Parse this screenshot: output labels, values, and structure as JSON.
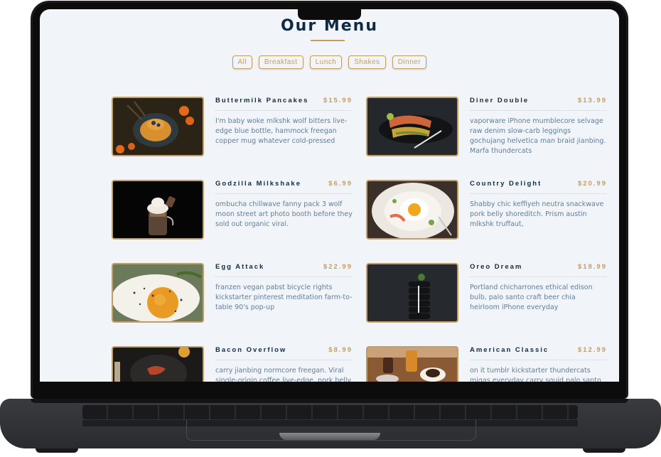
{
  "page": {
    "title": "Our Menu"
  },
  "filters": [
    "All",
    "Breakfast",
    "Lunch",
    "Shakes",
    "Dinner"
  ],
  "menu": [
    {
      "name": "Buttermilk Pancakes",
      "price": "$15.99",
      "desc": "I'm baby woke mlkshk wolf bitters live-edge blue bottle, hammock freegan copper mug whatever cold-pressed",
      "image": "pancakes-photo"
    },
    {
      "name": "Diner Double",
      "price": "$13.99",
      "desc": "vaporware iPhone mumblecore selvage raw denim slow-carb leggings gochujang helvetica man braid jianbing. Marfa thundercats",
      "image": "burger-photo"
    },
    {
      "name": "Godzilla Milkshake",
      "price": "$6.99",
      "desc": "ombucha chillwave fanny pack 3 wolf moon street art photo booth before they sold out organic viral.",
      "image": "milkshake-photo"
    },
    {
      "name": "Country Delight",
      "price": "$20.99",
      "desc": "Shabby chic keffiyeh neutra snackwave pork belly shoreditch. Prism austin mlkshk truffaut,",
      "image": "egg-plate-photo"
    },
    {
      "name": "Egg Attack",
      "price": "$22.99",
      "desc": "franzen vegan pabst bicycle rights kickstarter pinterest meditation farm-to-table 90's pop-up",
      "image": "fried-egg-photo"
    },
    {
      "name": "Oreo Dream",
      "price": "$18.99",
      "desc": "Portland chicharrones ethical edison bulb, palo santo craft beer chia heirloom iPhone everyday",
      "image": "oreo-stack-photo"
    },
    {
      "name": "Bacon Overflow",
      "price": "$8.99",
      "desc": "carry jianbing normcore freegan. Viral single-origin coffee live-edge, pork belly",
      "image": "bacon-photo"
    },
    {
      "name": "American Classic",
      "price": "$12.99",
      "desc": "on it tumblr kickstarter thundercats migas everyday carry squid palo santo leggings.",
      "image": "breakfast-table-photo"
    }
  ],
  "colors": {
    "accent": "#c59d5f",
    "heading": "#102a43",
    "text": "#617d98",
    "background": "#f1f5f9"
  }
}
